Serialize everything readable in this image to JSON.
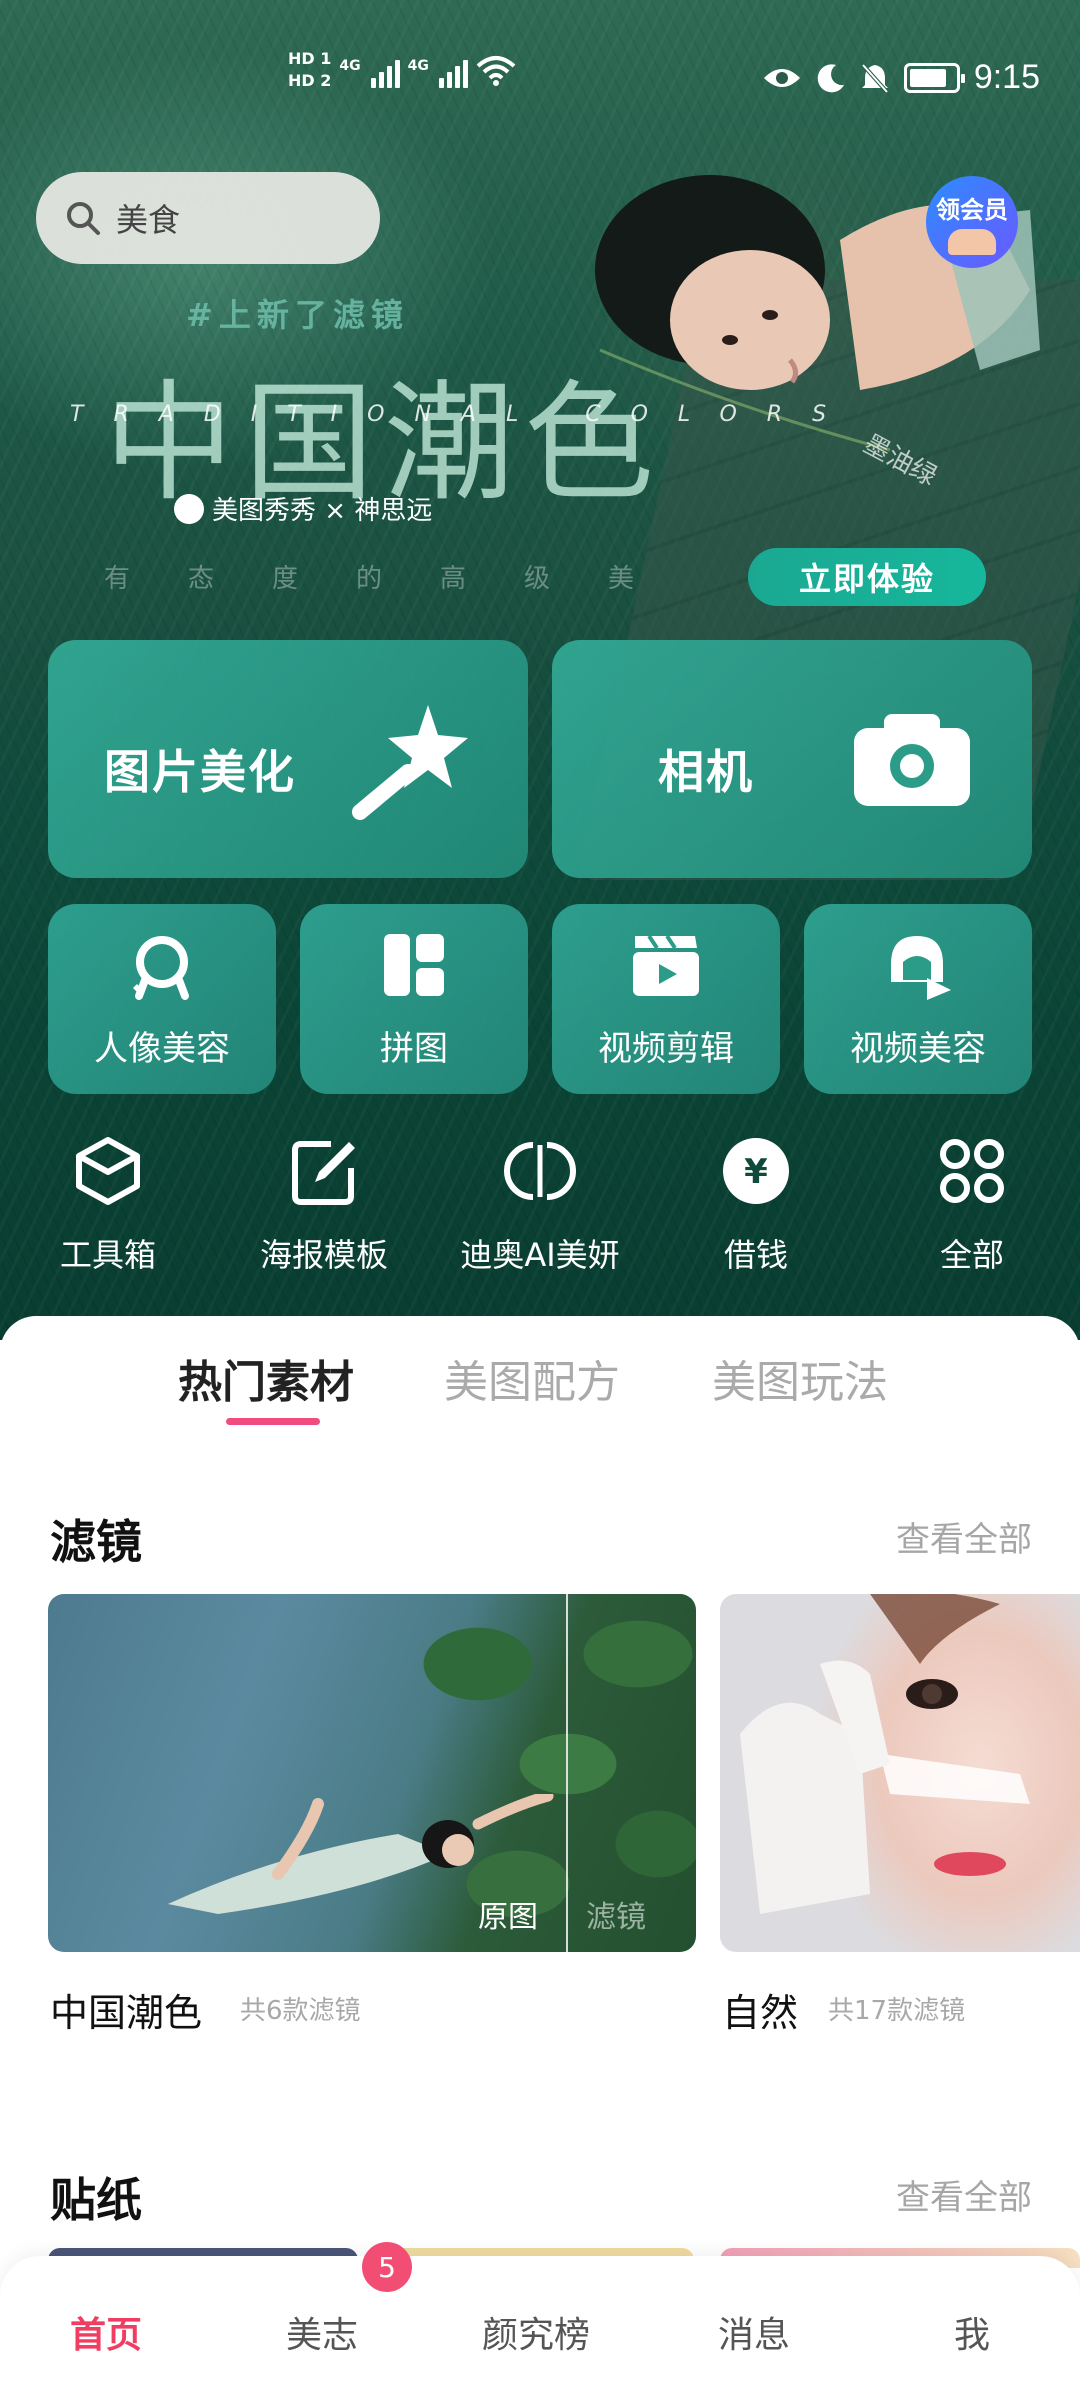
{
  "status_bar": {
    "hd1": "HD 1",
    "hd2": "HD 2",
    "net1": "4G",
    "net2": "4G",
    "time": "9:15"
  },
  "search": {
    "placeholder": "美食",
    "icon": "search-icon"
  },
  "vip_badge": {
    "label": "领会员"
  },
  "banner": {
    "tag": "#上新了滤镜",
    "title": "中国潮色",
    "subtitle": "TRADITIONAL COLORS",
    "brand": "美图秀秀 × 神思远",
    "slogan": "有态度的高级美",
    "photo_tag": "墨油绿",
    "cta": "立即体验"
  },
  "big_tiles": [
    {
      "label": "图片美化",
      "icon": "magic-wand-icon"
    },
    {
      "label": "相机",
      "icon": "camera-icon"
    }
  ],
  "small_tiles": [
    {
      "label": "人像美容",
      "icon": "portrait-icon"
    },
    {
      "label": "拼图",
      "icon": "collage-icon"
    },
    {
      "label": "视频剪辑",
      "icon": "clapperboard-icon"
    },
    {
      "label": "视频美容",
      "icon": "video-face-icon"
    }
  ],
  "tools": [
    {
      "label": "工具箱",
      "icon": "cube-icon"
    },
    {
      "label": "海报模板",
      "icon": "edit-poster-icon"
    },
    {
      "label": "迪奥AI美妍",
      "icon": "dior-logo-icon"
    },
    {
      "label": "借钱",
      "icon": "yuan-icon",
      "glyph": "¥"
    },
    {
      "label": "全部",
      "icon": "grid-icon"
    }
  ],
  "tabs": [
    {
      "label": "热门素材",
      "active": true
    },
    {
      "label": "美图配方",
      "active": false
    },
    {
      "label": "美图玩法",
      "active": false
    }
  ],
  "filters": {
    "title": "滤镜",
    "view_all": "查看全部",
    "cards": [
      {
        "name": "中国潮色",
        "count": "共6款滤镜",
        "before_label": "原图",
        "after_label": "滤镜"
      },
      {
        "name": "自然",
        "count": "共17款滤镜"
      }
    ]
  },
  "stickers": {
    "title": "贴纸",
    "view_all": "查看全部"
  },
  "bottom_nav": {
    "items": [
      {
        "label": "首页",
        "active": true
      },
      {
        "label": "美志",
        "active": false,
        "badge": "5"
      },
      {
        "label": "颜究榜",
        "active": false
      },
      {
        "label": "消息",
        "active": false
      },
      {
        "label": "我",
        "active": false
      }
    ]
  },
  "colors": {
    "accent_pink": "#ef3e62",
    "tile_teal": "#2ea592",
    "hero_green": "#0f4a3b"
  }
}
